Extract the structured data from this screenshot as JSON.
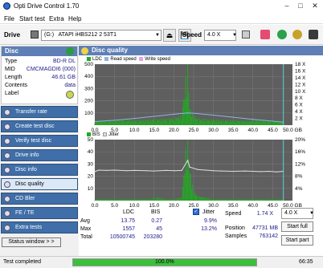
{
  "app": {
    "title": "Opti Drive Control 1.70"
  },
  "menu": [
    "File",
    "Start test",
    "Extra",
    "Help"
  ],
  "toolbar": {
    "drive_label": "Drive",
    "drive_letter": "(G:)",
    "drive_name": "ATAPI iHBS212  2 53T1",
    "speed_label": "Speed",
    "speed_value": "4.0 X"
  },
  "disc": {
    "header": "Disc",
    "rows": [
      {
        "key": "Type",
        "value": "BD-R DL"
      },
      {
        "key": "MID",
        "value": "CMCMAGDI6 (000)"
      },
      {
        "key": "Length",
        "value": "46.61 GB"
      },
      {
        "key": "Contents",
        "value": "data"
      },
      {
        "key": "Label",
        "value": ""
      }
    ]
  },
  "nav": [
    {
      "label": "Transfer rate",
      "active": false
    },
    {
      "label": "Create test disc",
      "active": false
    },
    {
      "label": "Verify test disc",
      "active": false
    },
    {
      "label": "Drive info",
      "active": false
    },
    {
      "label": "Disc info",
      "active": false
    },
    {
      "label": "Disc quality",
      "active": true
    },
    {
      "label": "CD Bler",
      "active": false
    },
    {
      "label": "FE / TE",
      "active": false
    },
    {
      "label": "Extra tests",
      "active": false
    }
  ],
  "status_window_btn": "Status window > >",
  "main": {
    "header": "Disc quality"
  },
  "chart_top": {
    "legend": [
      "LDC",
      "Read speed",
      "Write speed"
    ],
    "y_left_ticks": [
      "500",
      "400",
      "300",
      "200",
      "100"
    ],
    "y_right_ticks": [
      "18 X",
      "16 X",
      "14 X",
      "12 X",
      "10 X",
      "8 X",
      "6 X",
      "4 X",
      "2 X"
    ],
    "x_ticks": [
      "0.0",
      "5.0",
      "10.0",
      "15.0",
      "20.0",
      "25.0",
      "30.0",
      "35.0",
      "40.0",
      "45.0",
      "50.0 GB"
    ]
  },
  "chart_bottom": {
    "legend": [
      "BIS",
      "Jitter"
    ],
    "y_left_ticks": [
      "50",
      "40",
      "30",
      "20",
      "10"
    ],
    "y_right_ticks": [
      "20%",
      "16%",
      "12%",
      "8%",
      "4%"
    ],
    "x_ticks": [
      "0.0",
      "5.0",
      "10.0",
      "15.0",
      "20.0",
      "25.0",
      "30.0",
      "35.0",
      "40.0",
      "45.0",
      "50.0 GB"
    ]
  },
  "chart_data": [
    {
      "type": "area",
      "title": "",
      "xlabel": "GB",
      "xlim": [
        0,
        50
      ],
      "ylim_left": [
        0,
        500
      ],
      "ylim_right": [
        0,
        20
      ],
      "series": [
        {
          "name": "LDC",
          "color": "#22aa22",
          "x": [
            0,
            2,
            4,
            6,
            8,
            10,
            12,
            14,
            16,
            18,
            20,
            22,
            23.5,
            24,
            25,
            26,
            28,
            30,
            32,
            34,
            36,
            38,
            40,
            42,
            44,
            46,
            47.7
          ],
          "y": [
            25,
            30,
            28,
            32,
            35,
            30,
            33,
            36,
            38,
            40,
            45,
            60,
            400,
            110,
            60,
            42,
            38,
            35,
            33,
            32,
            30,
            28,
            30,
            32,
            30,
            28,
            26
          ]
        },
        {
          "name": "Read speed",
          "color": "#8ab4e8",
          "x": [
            0,
            5,
            10,
            15,
            20,
            23.5,
            25,
            30,
            35,
            40,
            45,
            47.7
          ],
          "y": [
            1.2,
            1.6,
            2.2,
            2.9,
            3.6,
            4.0,
            3.9,
            3.3,
            2.6,
            1.9,
            1.3,
            1.0
          ]
        }
      ]
    },
    {
      "type": "area",
      "title": "",
      "xlabel": "GB",
      "xlim": [
        0,
        50
      ],
      "ylim_left": [
        0,
        50
      ],
      "ylim_right": [
        0,
        20
      ],
      "series": [
        {
          "name": "BIS",
          "color": "#22aa22",
          "x": [
            0,
            2,
            4,
            6,
            8,
            10,
            12,
            14,
            16,
            18,
            20,
            22,
            23.5,
            24,
            25,
            26,
            28,
            30,
            32,
            34,
            36,
            38,
            40,
            42,
            44,
            46,
            47.7
          ],
          "y": [
            1,
            1,
            1,
            1,
            1,
            1,
            1,
            1,
            2,
            1,
            1,
            2,
            45,
            20,
            6,
            3,
            2,
            1,
            1,
            1,
            1,
            1,
            1,
            1,
            1,
            1,
            1
          ]
        },
        {
          "name": "Jitter",
          "color": "#e0e0e0",
          "x": [
            0,
            1,
            3,
            5,
            8,
            10,
            13,
            15,
            18,
            20,
            22,
            23.5,
            24,
            26,
            28,
            30,
            32,
            35,
            38,
            40,
            42,
            44,
            46,
            47.7
          ],
          "y": [
            9.5,
            10.0,
            9.9,
            10.0,
            9.8,
            9.9,
            9.8,
            9.7,
            9.9,
            9.8,
            9.9,
            13.2,
            11.0,
            10.2,
            10.0,
            9.8,
            9.7,
            9.6,
            9.7,
            9.6,
            9.5,
            9.6,
            9.4,
            9.6
          ]
        }
      ]
    }
  ],
  "stats": {
    "col_headers": [
      "LDC",
      "BIS"
    ],
    "avg_label": "Avg",
    "avg_ldc": "13.75",
    "avg_bis": "0.27",
    "max_label": "Max",
    "max_ldc": "1557",
    "max_bis": "45",
    "total_label": "Total",
    "total_ldc": "10500745",
    "total_bis": "203280",
    "jitter_label": "Jitter",
    "jitter_avg": "9.9%",
    "jitter_max": "13.2%",
    "speed_label": "Speed",
    "speed_value": "1.74 X",
    "speed_select": "4.0 X",
    "position_label": "Position",
    "position_value": "47731 MB",
    "samples_label": "Samples",
    "samples_value": "763142",
    "start_full": "Start full",
    "start_part": "Start part"
  },
  "statusbar": {
    "text": "Test completed",
    "progress": "100.0%",
    "time": "66:35",
    "progress_fraction": 1.0
  }
}
